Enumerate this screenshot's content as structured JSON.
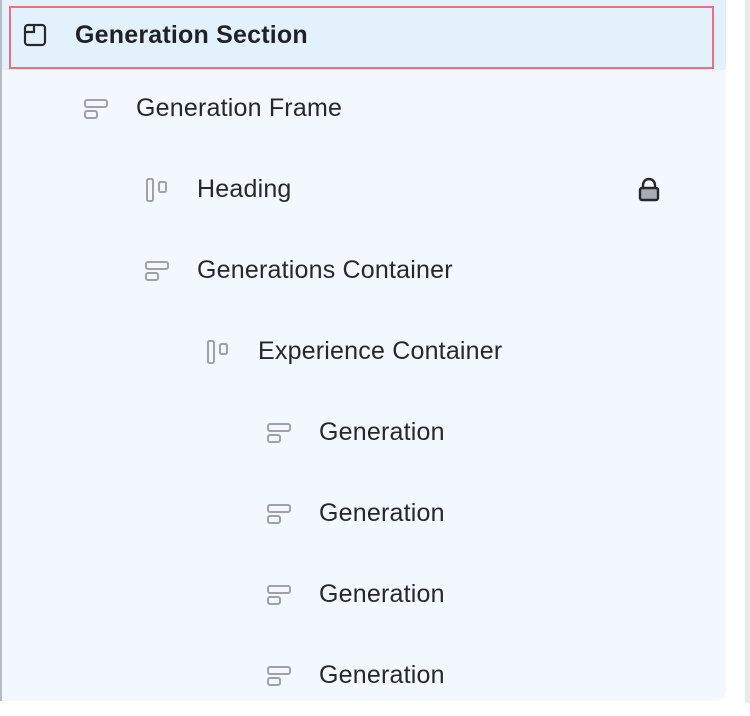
{
  "layers": [
    {
      "label": "Generation Section",
      "icon": "section-icon",
      "level": 0,
      "selected": true,
      "locked": false
    },
    {
      "label": "Generation Frame",
      "icon": "frame-stack-icon",
      "level": 1,
      "selected": false,
      "locked": false
    },
    {
      "label": "Heading",
      "icon": "columns-icon",
      "level": 2,
      "selected": false,
      "locked": true
    },
    {
      "label": "Generations Container",
      "icon": "frame-stack-icon",
      "level": 2,
      "selected": false,
      "locked": false
    },
    {
      "label": "Experience Container",
      "icon": "columns-icon",
      "level": 3,
      "selected": false,
      "locked": false
    },
    {
      "label": "Generation",
      "icon": "frame-stack-icon",
      "level": 4,
      "selected": false,
      "locked": false
    },
    {
      "label": "Generation",
      "icon": "frame-stack-icon",
      "level": 4,
      "selected": false,
      "locked": false
    },
    {
      "label": "Generation",
      "icon": "frame-stack-icon",
      "level": 4,
      "selected": false,
      "locked": false
    },
    {
      "label": "Generation",
      "icon": "frame-stack-icon",
      "level": 4,
      "selected": false,
      "locked": false
    }
  ],
  "colors": {
    "panel_bg": "#f3f8fe",
    "selected_bg": "#e3f1fd",
    "selected_outline": "#e8707f",
    "icon_gray": "#9ea2a8"
  }
}
